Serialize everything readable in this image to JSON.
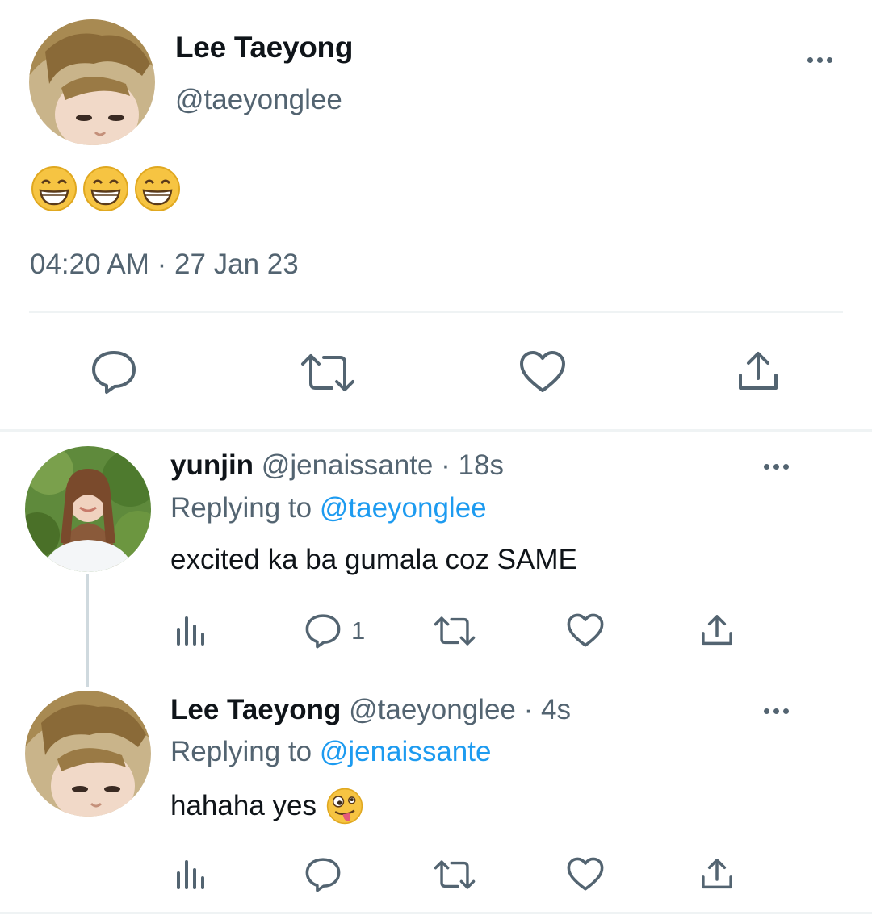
{
  "main_tweet": {
    "author_name": "Lee Taeyong",
    "handle": "@taeyonglee",
    "content_emojis": [
      "😁",
      "😁",
      "😁"
    ],
    "timestamp": "04:20 AM · 27 Jan 23",
    "actions": [
      "reply-icon",
      "retweet-icon",
      "like-icon",
      "share-icon"
    ]
  },
  "replies": [
    {
      "author_name": "yunjin",
      "handle": "@jenaissante",
      "time": "· 18s",
      "replying_to_label": "Replying to",
      "replying_to_handle": "@taeyonglee",
      "text": "excited ka ba gumala coz SAME",
      "reply_count": "1"
    },
    {
      "author_name": "Lee Taeyong",
      "handle": "@taeyonglee",
      "time": "· 4s",
      "replying_to_label": "Replying to",
      "replying_to_handle": "@jenaissante",
      "text": "hahaha yes",
      "emoji": "🤪"
    }
  ],
  "colors": {
    "text": "#0f1419",
    "muted": "#536471",
    "link": "#1d9bf0",
    "divider": "#eff3f4"
  }
}
